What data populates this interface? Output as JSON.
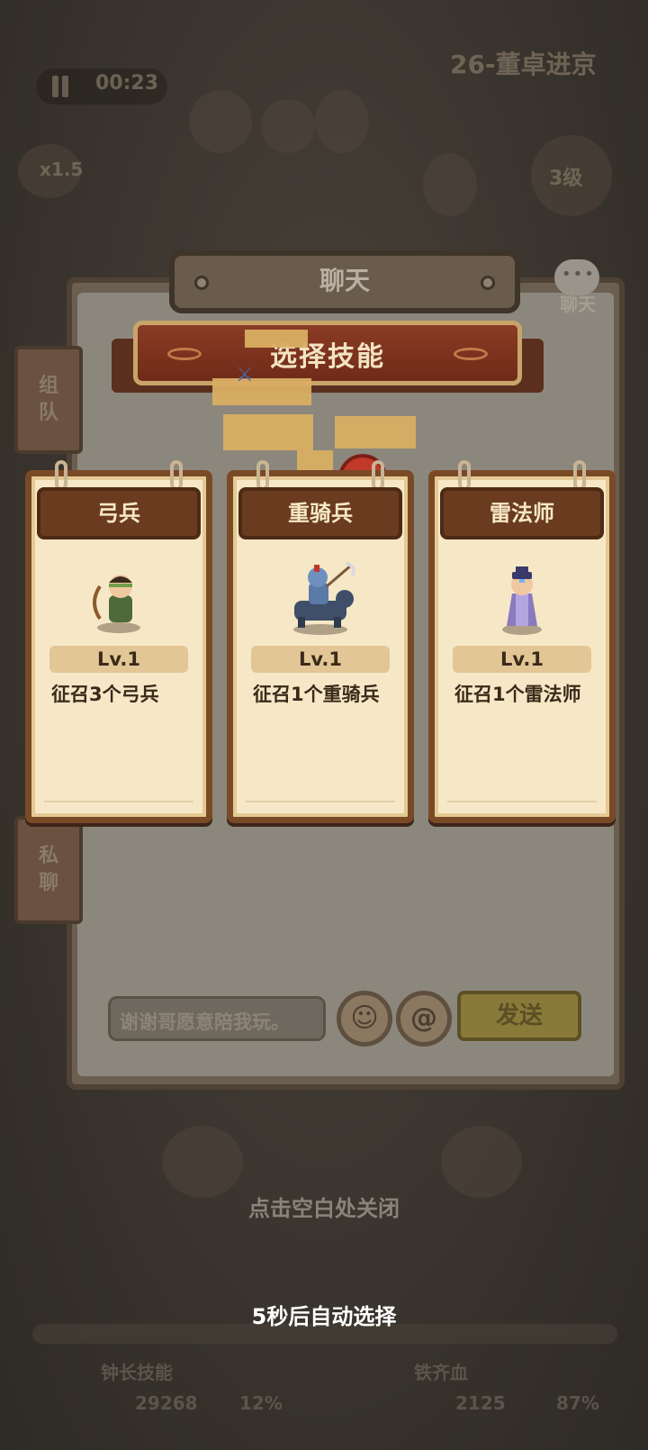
{
  "background": {
    "stage_title": "26-董卓进京",
    "timer": "00:23",
    "speed": "x1.5",
    "level": "3级",
    "bottom_left_label": "钟长技能",
    "bottom_left_value": "29268",
    "bottom_left_pct": "12%",
    "bottom_right_label": "铁齐血",
    "bottom_right_value": "2125",
    "bottom_right_pct": "87%"
  },
  "chat": {
    "title": "聊天",
    "side_label": "聊天",
    "tabs": [
      {
        "label": "组\n队"
      },
      {
        "label": "私\n聊"
      }
    ],
    "input_placeholder": "谢谢哥愿意陪我玩。",
    "emoji_icon": "☺",
    "at_icon": "@",
    "send_label": "发送"
  },
  "skill_select": {
    "title": "选择技能",
    "cards": [
      {
        "name": "弓兵",
        "level": "Lv.1",
        "desc": "征召3个弓兵",
        "character": "archer"
      },
      {
        "name": "重骑兵",
        "level": "Lv.1",
        "desc": "征召1个重骑兵",
        "character": "heavy-cavalry"
      },
      {
        "name": "雷法师",
        "level": "Lv.1",
        "desc": "征召1个雷法师",
        "character": "thunder-mage"
      }
    ],
    "close_hint": "点击空白处关闭",
    "auto_select": "5秒后自动选择"
  },
  "colors": {
    "card_bg": "#f6e8c7",
    "card_border": "#7a4a26",
    "banner_red": "#8a3b24"
  }
}
